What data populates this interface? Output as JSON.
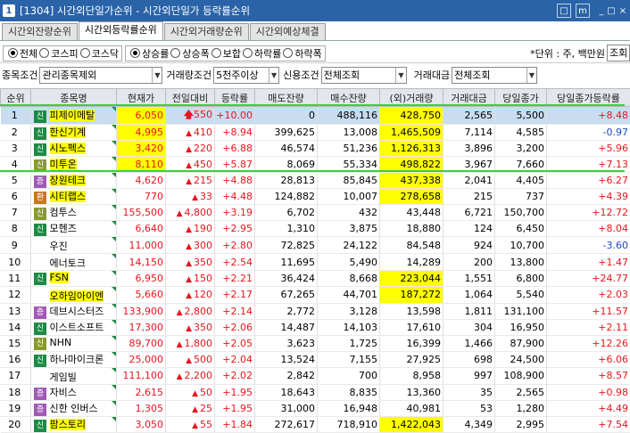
{
  "window": {
    "number": "1",
    "title": "[1304] 시간외단일가순위 - 시간외단일가 등락률순위",
    "buttons": [
      "□",
      "m",
      "_",
      "□",
      "×"
    ]
  },
  "tabs": [
    {
      "label": "시간외잔량순위",
      "active": false
    },
    {
      "label": "시간외등락률순위",
      "active": true
    },
    {
      "label": "시간외거래량순위",
      "active": false
    },
    {
      "label": "시간외예상체결",
      "active": false
    }
  ],
  "market": {
    "options": [
      "전체",
      "코스피",
      "코스닥"
    ],
    "selected": 0
  },
  "sort": {
    "options": [
      "상승률",
      "상승폭",
      "보합",
      "하락률",
      "하락폭"
    ],
    "selected": 0
  },
  "unit_label": "*단위 : 주, 백만원",
  "unit_select": "조회",
  "filters": [
    {
      "label": "종목조건",
      "value": "관리종목제외"
    },
    {
      "label": "거래량조건",
      "value": "5천주이상"
    },
    {
      "label": "신용조건",
      "value": "전체조회"
    },
    {
      "label": "거래대금",
      "value": "전체조회"
    }
  ],
  "columns": [
    "순위",
    "종목명",
    "현재가",
    "전일대비",
    "등락률",
    "매도잔량",
    "매수잔량",
    "(외)거래량",
    "거래대금",
    "당일종가",
    "당일종가등락률"
  ],
  "colors": {
    "up": "#e8141e",
    "down": "#1e46d2",
    "highlight": "#ffff00",
    "selected_row": "#c9dcf0",
    "green_line": "#3ad13a"
  },
  "rows": [
    {
      "rank": "1",
      "badge": "신",
      "badge_color": "#1d8a45",
      "name": "피제이메탈",
      "price": "6,050",
      "dir": "upper",
      "change": "550",
      "rate": "+10.00",
      "ask": "0",
      "bid": "488,116",
      "vol": "428,750",
      "amt": "2,565",
      "close": "5,500",
      "close_rate": "+8.48",
      "close_dir": "up",
      "hl_name": true,
      "hl_price": true,
      "hl_vol": true,
      "selected": true
    },
    {
      "rank": "2",
      "badge": "신",
      "badge_color": "#1d8a45",
      "name": "한신기계",
      "price": "4,995",
      "dir": "up",
      "change": "410",
      "rate": "+8.94",
      "ask": "399,625",
      "bid": "13,008",
      "vol": "1,465,509",
      "amt": "7,114",
      "close": "4,585",
      "close_rate": "-0.97",
      "close_dir": "down",
      "hl_name": true,
      "hl_price": true,
      "hl_vol": true,
      "selected": false
    },
    {
      "rank": "3",
      "badge": "신",
      "badge_color": "#1d8a45",
      "name": "시노펙스",
      "price": "3,420",
      "dir": "up",
      "change": "220",
      "rate": "+6.88",
      "ask": "46,574",
      "bid": "51,236",
      "vol": "1,126,313",
      "amt": "3,896",
      "close": "3,200",
      "close_rate": "+5.96",
      "close_dir": "up",
      "hl_name": true,
      "hl_price": true,
      "hl_vol": true,
      "selected": false
    },
    {
      "rank": "4",
      "badge": "신",
      "badge_color": "#8a9a2a",
      "name": "미투온",
      "price": "8,110",
      "dir": "up",
      "change": "450",
      "rate": "+5.87",
      "ask": "8,069",
      "bid": "55,334",
      "vol": "498,822",
      "amt": "3,967",
      "close": "7,660",
      "close_rate": "+7.13",
      "close_dir": "up",
      "hl_name": true,
      "hl_price": true,
      "hl_vol": true,
      "selected": false
    },
    {
      "rank": "5",
      "badge": "증",
      "badge_color": "#a05ab4",
      "name": "장원테크",
      "price": "4,620",
      "dir": "up",
      "change": "215",
      "rate": "+4.88",
      "ask": "28,813",
      "bid": "85,845",
      "vol": "437,338",
      "amt": "2,041",
      "close": "4,405",
      "close_rate": "+6.27",
      "close_dir": "up",
      "hl_name": true,
      "hl_price": false,
      "hl_vol": true,
      "selected": false
    },
    {
      "rank": "6",
      "badge": "환",
      "badge_color": "#c87814",
      "name": "시티랩스",
      "price": "770",
      "dir": "up",
      "change": "33",
      "rate": "+4.48",
      "ask": "124,882",
      "bid": "10,007",
      "vol": "278,658",
      "amt": "215",
      "close": "737",
      "close_rate": "+4.39",
      "close_dir": "up",
      "hl_name": true,
      "hl_price": false,
      "hl_vol": true,
      "selected": false
    },
    {
      "rank": "7",
      "badge": "신",
      "badge_color": "#8a9a2a",
      "name": "컴투스",
      "price": "155,500",
      "dir": "up",
      "change": "4,800",
      "rate": "+3.19",
      "ask": "6,702",
      "bid": "432",
      "vol": "43,448",
      "amt": "6,721",
      "close": "150,700",
      "close_rate": "+12.72",
      "close_dir": "up",
      "hl_name": false,
      "hl_price": false,
      "hl_vol": false,
      "selected": false
    },
    {
      "rank": "8",
      "badge": "신",
      "badge_color": "#1d8a45",
      "name": "모헨즈",
      "price": "6,640",
      "dir": "up",
      "change": "190",
      "rate": "+2.95",
      "ask": "1,310",
      "bid": "3,875",
      "vol": "18,880",
      "amt": "124",
      "close": "6,450",
      "close_rate": "+8.04",
      "close_dir": "up",
      "hl_name": false,
      "hl_price": false,
      "hl_vol": false,
      "selected": false
    },
    {
      "rank": "9",
      "badge": "",
      "badge_color": "",
      "name": "우진",
      "price": "11,000",
      "dir": "up",
      "change": "300",
      "rate": "+2.80",
      "ask": "72,825",
      "bid": "24,122",
      "vol": "84,548",
      "amt": "924",
      "close": "10,700",
      "close_rate": "-3.60",
      "close_dir": "down",
      "hl_name": false,
      "hl_price": false,
      "hl_vol": false,
      "selected": false
    },
    {
      "rank": "10",
      "badge": "",
      "badge_color": "",
      "name": "에너토크",
      "price": "14,150",
      "dir": "up",
      "change": "350",
      "rate": "+2.54",
      "ask": "11,695",
      "bid": "5,490",
      "vol": "14,289",
      "amt": "200",
      "close": "13,800",
      "close_rate": "+1.47",
      "close_dir": "up",
      "hl_name": false,
      "hl_price": false,
      "hl_vol": false,
      "selected": false
    },
    {
      "rank": "11",
      "badge": "신",
      "badge_color": "#1d8a45",
      "name": "FSN",
      "price": "6,950",
      "dir": "up",
      "change": "150",
      "rate": "+2.21",
      "ask": "36,424",
      "bid": "8,668",
      "vol": "223,044",
      "amt": "1,551",
      "close": "6,800",
      "close_rate": "+24.77",
      "close_dir": "up",
      "hl_name": true,
      "hl_price": false,
      "hl_vol": true,
      "selected": false
    },
    {
      "rank": "12",
      "badge": "",
      "badge_color": "",
      "name": "오하임아이엔",
      "price": "5,660",
      "dir": "up",
      "change": "120",
      "rate": "+2.17",
      "ask": "67,265",
      "bid": "44,701",
      "vol": "187,272",
      "amt": "1,064",
      "close": "5,540",
      "close_rate": "+2.03",
      "close_dir": "up",
      "hl_name": true,
      "hl_price": false,
      "hl_vol": true,
      "selected": false
    },
    {
      "rank": "13",
      "badge": "증",
      "badge_color": "#a05ab4",
      "name": "데브시스터즈",
      "price": "133,900",
      "dir": "up",
      "change": "2,800",
      "rate": "+2.14",
      "ask": "2,772",
      "bid": "3,128",
      "vol": "13,598",
      "amt": "1,811",
      "close": "131,100",
      "close_rate": "+11.57",
      "close_dir": "up",
      "hl_name": false,
      "hl_price": false,
      "hl_vol": false,
      "selected": false
    },
    {
      "rank": "14",
      "badge": "신",
      "badge_color": "#1d8a45",
      "name": "이스트소프트",
      "price": "17,300",
      "dir": "up",
      "change": "350",
      "rate": "+2.06",
      "ask": "14,487",
      "bid": "14,103",
      "vol": "17,610",
      "amt": "304",
      "close": "16,950",
      "close_rate": "+2.11",
      "close_dir": "up",
      "hl_name": false,
      "hl_price": false,
      "hl_vol": false,
      "selected": false
    },
    {
      "rank": "15",
      "badge": "신",
      "badge_color": "#8a9a2a",
      "name": "NHN",
      "price": "89,700",
      "dir": "up",
      "change": "1,800",
      "rate": "+2.05",
      "ask": "3,623",
      "bid": "1,725",
      "vol": "16,399",
      "amt": "1,466",
      "close": "87,900",
      "close_rate": "+12.26",
      "close_dir": "up",
      "hl_name": false,
      "hl_price": false,
      "hl_vol": false,
      "selected": false
    },
    {
      "rank": "16",
      "badge": "신",
      "badge_color": "#1d8a45",
      "name": "하나마이크론",
      "price": "25,000",
      "dir": "up",
      "change": "500",
      "rate": "+2.04",
      "ask": "13,524",
      "bid": "7,155",
      "vol": "27,925",
      "amt": "698",
      "close": "24,500",
      "close_rate": "+6.06",
      "close_dir": "up",
      "hl_name": false,
      "hl_price": false,
      "hl_vol": false,
      "selected": false
    },
    {
      "rank": "17",
      "badge": "",
      "badge_color": "",
      "name": "게임빌",
      "price": "111,100",
      "dir": "up",
      "change": "2,200",
      "rate": "+2.02",
      "ask": "2,842",
      "bid": "700",
      "vol": "8,958",
      "amt": "997",
      "close": "108,900",
      "close_rate": "+8.57",
      "close_dir": "up",
      "hl_name": false,
      "hl_price": false,
      "hl_vol": false,
      "selected": false
    },
    {
      "rank": "18",
      "badge": "증",
      "badge_color": "#a05ab4",
      "name": "자비스",
      "price": "2,615",
      "dir": "up",
      "change": "50",
      "rate": "+1.95",
      "ask": "18,643",
      "bid": "8,835",
      "vol": "13,360",
      "amt": "35",
      "close": "2,565",
      "close_rate": "+0.98",
      "close_dir": "up",
      "hl_name": false,
      "hl_price": false,
      "hl_vol": false,
      "selected": false
    },
    {
      "rank": "19",
      "badge": "증",
      "badge_color": "#a05ab4",
      "name": "신한 인버스",
      "price": "1,305",
      "dir": "up",
      "change": "25",
      "rate": "+1.95",
      "ask": "31,000",
      "bid": "16,948",
      "vol": "40,981",
      "amt": "53",
      "close": "1,280",
      "close_rate": "+4.49",
      "close_dir": "up",
      "hl_name": false,
      "hl_price": false,
      "hl_vol": false,
      "selected": false
    },
    {
      "rank": "20",
      "badge": "신",
      "badge_color": "#1d8a45",
      "name": "팜스토리",
      "price": "3,050",
      "dir": "up",
      "change": "55",
      "rate": "+1.84",
      "ask": "272,617",
      "bid": "718,910",
      "vol": "1,422,043",
      "amt": "4,349",
      "close": "2,995",
      "close_rate": "+7.54",
      "close_dir": "up",
      "hl_name": true,
      "hl_price": false,
      "hl_vol": true,
      "selected": false
    }
  ]
}
